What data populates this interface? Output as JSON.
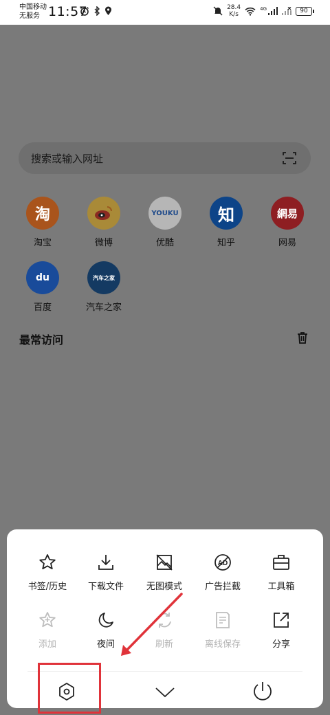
{
  "statusbar": {
    "carrier_1": "中国移动",
    "carrier_2": "无服务",
    "time": "11:57",
    "net_speed_value": "28.4",
    "net_speed_unit": "K/s",
    "network_type": "4G",
    "battery": "90"
  },
  "search": {
    "placeholder": "搜索或输入网址"
  },
  "shortcuts": [
    {
      "label": "淘宝",
      "glyph": "淘",
      "color": "#e8661b"
    },
    {
      "label": "微博",
      "glyph": "",
      "color": "#e2a51d"
    },
    {
      "label": "优酷",
      "glyph": "YOUKU",
      "color": "#e6e6e6"
    },
    {
      "label": "知乎",
      "glyph": "知",
      "color": "#0f5ba8"
    },
    {
      "label": "网易",
      "glyph": "網易",
      "color": "#c81f25"
    },
    {
      "label": "百度",
      "glyph": "du",
      "color": "#1c5fc8"
    },
    {
      "label": "汽车之家",
      "glyph": "汽车之家",
      "color": "#17497e"
    }
  ],
  "frequent": {
    "title": "最常访问"
  },
  "menu": {
    "row1": [
      {
        "label": "书签/历史",
        "icon": "star-outline-icon"
      },
      {
        "label": "下载文件",
        "icon": "download-icon"
      },
      {
        "label": "无图模式",
        "icon": "no-image-icon"
      },
      {
        "label": "广告拦截",
        "icon": "ad-block-icon"
      },
      {
        "label": "工具箱",
        "icon": "toolbox-icon"
      }
    ],
    "row2": [
      {
        "label": "添加",
        "icon": "add-star-icon",
        "disabled": true
      },
      {
        "label": "夜间",
        "icon": "moon-icon",
        "disabled": false
      },
      {
        "label": "刷新",
        "icon": "refresh-icon",
        "disabled": true
      },
      {
        "label": "离线保存",
        "icon": "offline-save-icon",
        "disabled": true
      },
      {
        "label": "分享",
        "icon": "share-icon",
        "disabled": false
      }
    ]
  },
  "colors": {
    "highlight": "#e0333a",
    "overlay": "#7a7a7a"
  }
}
